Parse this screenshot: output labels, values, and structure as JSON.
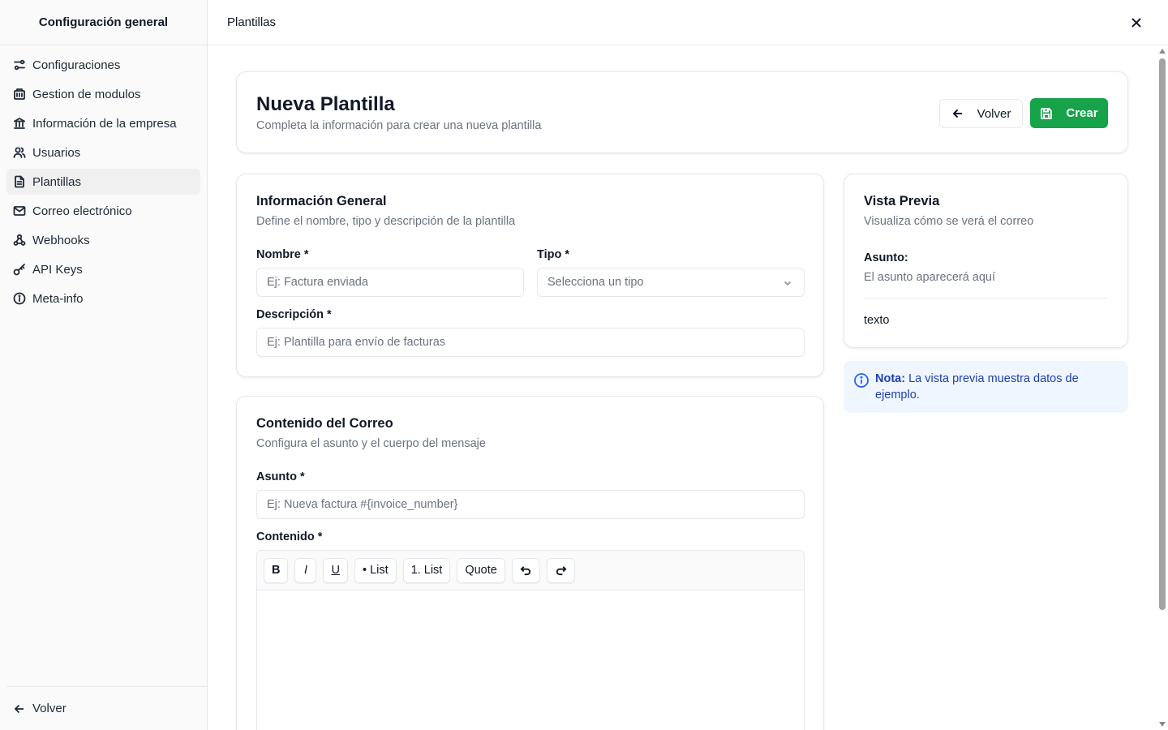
{
  "sidebar": {
    "title": "Configuración general",
    "items": [
      {
        "label": "Configuraciones",
        "icon": "sliders-icon"
      },
      {
        "label": "Gestion de modulos",
        "icon": "modules-icon"
      },
      {
        "label": "Información de la empresa",
        "icon": "bank-icon"
      },
      {
        "label": "Usuarios",
        "icon": "users-icon"
      },
      {
        "label": "Plantillas",
        "icon": "file-text-icon",
        "active": true
      },
      {
        "label": "Correo electrónico",
        "icon": "mail-icon"
      },
      {
        "label": "Webhooks",
        "icon": "webhook-icon"
      },
      {
        "label": "API Keys",
        "icon": "key-icon"
      },
      {
        "label": "Meta-info",
        "icon": "info-icon"
      }
    ],
    "footer_label": "Volver"
  },
  "topbar": {
    "title": "Plantillas"
  },
  "header": {
    "title": "Nueva Plantilla",
    "subtitle": "Completa la información para crear una nueva plantilla",
    "back_label": "Volver",
    "create_label": "Crear",
    "create_color": "#16a34a"
  },
  "general": {
    "title": "Información General",
    "subtitle": "Define el nombre, tipo y descripción de la plantilla",
    "name_label": "Nombre *",
    "name_placeholder": "Ej: Factura enviada",
    "type_label": "Tipo *",
    "type_placeholder": "Selecciona un tipo",
    "description_label": "Descripción *",
    "description_placeholder": "Ej: Plantilla para envío de facturas"
  },
  "content": {
    "title": "Contenido del Correo",
    "subtitle": "Configura el asunto y el cuerpo del mensaje",
    "subject_label": "Asunto *",
    "subject_placeholder": "Ej: Nueva factura #{invoice_number}",
    "body_label": "Contenido *",
    "toolbar": {
      "bold": "B",
      "italic": "I",
      "underline": "U",
      "bullet_list": "• List",
      "ordered_list": "1. List",
      "quote": "Quote"
    }
  },
  "preview": {
    "title": "Vista Previa",
    "subtitle": "Visualiza cómo se verá el correo",
    "subject_label": "Asunto:",
    "subject_value": "El asunto aparecerá aquí",
    "body_value": "texto"
  },
  "note": {
    "bold": "Nota:",
    "text": " La vista previa muestra datos de ejemplo."
  }
}
